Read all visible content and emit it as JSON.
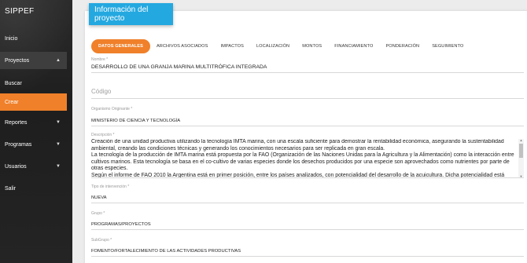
{
  "sidebar": {
    "brand": "SIPPEF",
    "items": [
      {
        "label": "Inicio",
        "caret": ""
      },
      {
        "label": "Proyectos",
        "caret": "▲"
      },
      {
        "label": "Buscar",
        "caret": ""
      },
      {
        "label": "Crear",
        "caret": ""
      },
      {
        "label": "Reportes",
        "caret": "▼"
      },
      {
        "label": "Programas",
        "caret": "▼"
      },
      {
        "label": "Usuarios",
        "caret": "▼"
      },
      {
        "label": "Salir",
        "caret": ""
      }
    ]
  },
  "header": {
    "title": "Información del proyecto"
  },
  "tabs": [
    "DATOS GENERALES",
    "ARCHIVOS ASOCIADOS",
    "IMPACTOS",
    "LOCALIZACIÓN",
    "MONTOS",
    "FINANCIAMIENTO",
    "PONDERACIÓN",
    "SEGUIMIENTO"
  ],
  "form": {
    "nombre_label": "Nombre *",
    "nombre_value": "DESARROLLO DE UNA GRANJA MARINA MULTITRÓFICA INTEGRADA",
    "codigo_placeholder": "Código",
    "organismo_label": "Organismo Originante *",
    "organismo_value": "MINISTERIO DE CIENCIA Y TECNOLOGÍA",
    "descripcion_label": "Descripción *",
    "descripcion_value": "Creación de una unidad productiva utilizando la tecnología IMTA marina, con una escala suficiente para demostrar la rentabilidad económica, asegurando la sustentabilidad ambiental, creando las condiciones técnicas y generando los conocimientos necesarios para ser replicada en gran escala.\nLa tecnología de la producción de IMTA marina está propuesta por la FAO (Organización de las Naciones Unidas para la Agricultura y la Alimentación) como la interacción entre cultivos marinos. Esta tecnología se basa en el co-cultivo de varias especies donde los desechos producidos por una especie son aprovechados como nutrientes por parte de otras especies.\nSegún el informe de FAO 2010 la Argentina está en primer posición, entre los países analizados, con potencialidad del desarrollo de la acuicultura. Dicha potencialidad está presente en",
    "tipo_label": "Tipo de intervención *",
    "tipo_value": "NUEVA",
    "grupo_label": "Grupo *",
    "grupo_value": "PROGRAMAS/PROYECTOS",
    "subgrupo_label": "SubGrupo *",
    "subgrupo_value": "FOMENTO/FORTALECIMIENTO DE LAS ACTIVIDADES PRODUCTIVAS"
  },
  "colors": {
    "accent": "#f0802a",
    "header": "#24a8e0"
  }
}
